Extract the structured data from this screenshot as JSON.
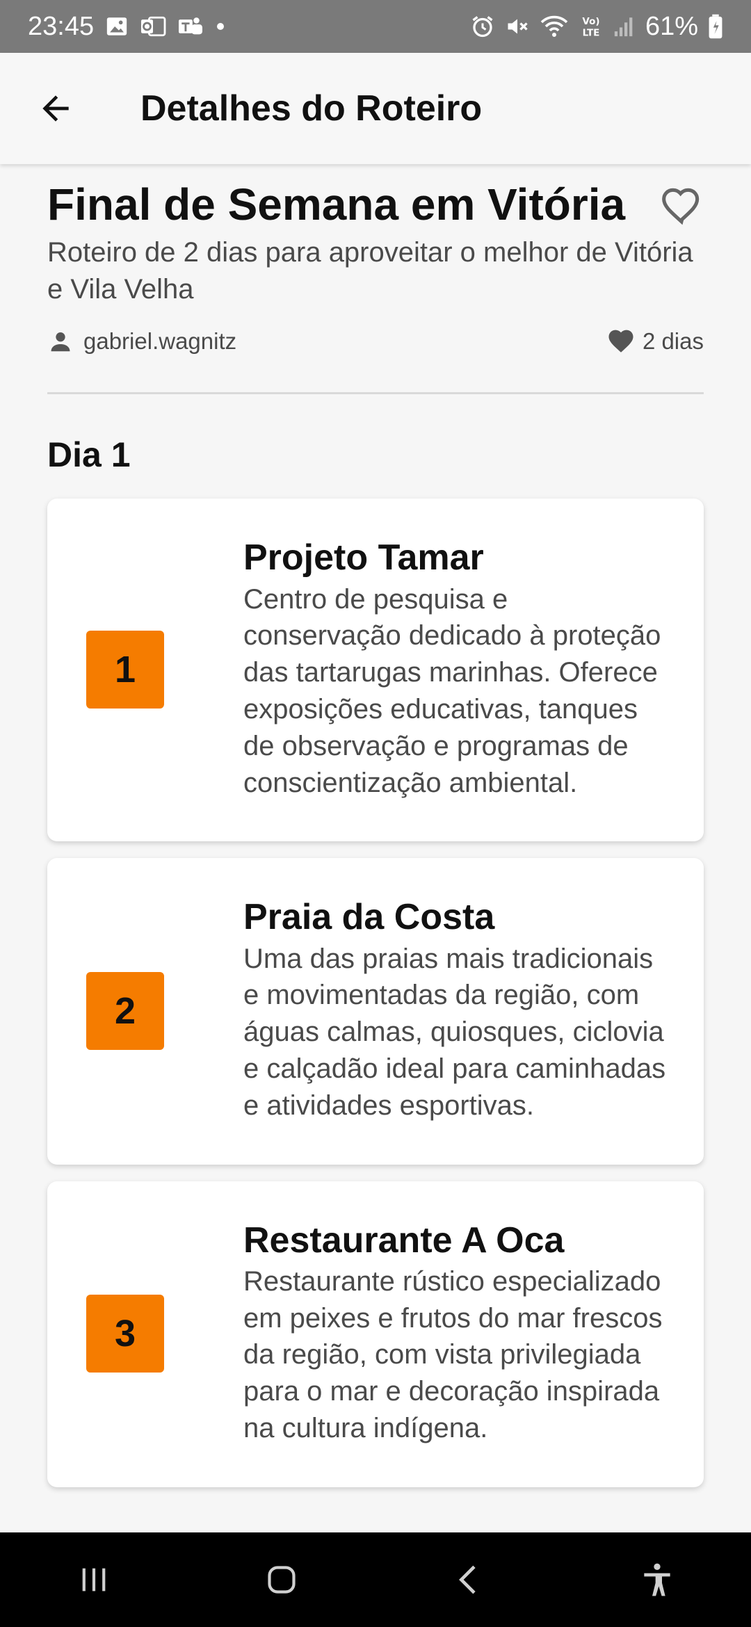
{
  "status_bar": {
    "time": "23:45",
    "battery": "61%",
    "left_icons": [
      "gallery-icon",
      "outlook-icon",
      "teams-icon",
      "dot-icon"
    ],
    "right_icons": [
      "alarm-icon",
      "mute-icon",
      "wifi-icon",
      "volte-icon",
      "signal-icon",
      "battery-icon"
    ]
  },
  "app_bar": {
    "title": "Detalhes do Roteiro",
    "back_icon": "arrow-back-icon"
  },
  "route": {
    "title": "Final de Semana em Vitória",
    "description": "Roteiro de 2 dias para aproveitar o melhor de Vitória e Vila Velha",
    "author": "gabriel.wagnitz",
    "duration": "2 dias",
    "favorite_icon": "heart-outline-icon"
  },
  "day": {
    "heading": "Dia 1",
    "stops": [
      {
        "number": "1",
        "title": "Projeto Tamar",
        "description": "Centro de pesquisa e conservação dedicado à proteção das tartarugas marinhas. Oferece exposições educativas, tanques de observação e programas de conscientização ambiental."
      },
      {
        "number": "2",
        "title": "Praia da Costa",
        "description": "Uma das praias mais tradicionais e movimentadas da região, com águas calmas, quiosques, ciclovia e calçadão ideal para caminhadas e atividades esportivas."
      },
      {
        "number": "3",
        "title": "Restaurante A Oca",
        "description": "Restaurante rústico especializado em peixes e frutos do mar frescos da região, com vista privilegiada para o mar e decoração inspirada na cultura indígena."
      }
    ]
  },
  "colors": {
    "accent": "#f57c00",
    "status_bar": "#7a7a7a",
    "background": "#f6f6f6"
  },
  "nav_bar": {
    "icons": [
      "recent-apps-icon",
      "home-icon",
      "back-icon",
      "accessibility-icon"
    ]
  }
}
